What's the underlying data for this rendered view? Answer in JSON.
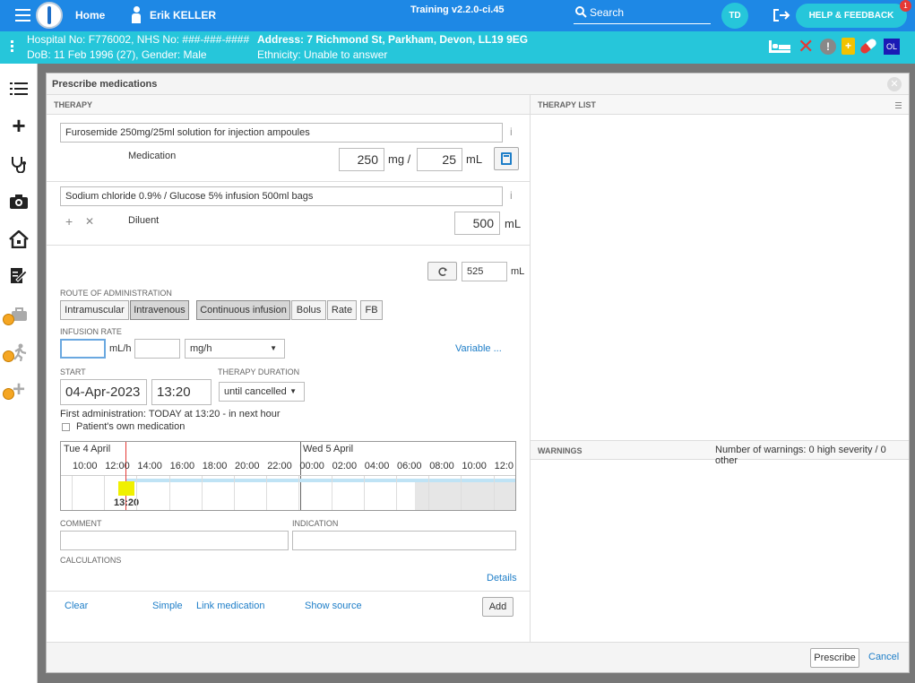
{
  "topbar": {
    "home": "Home",
    "user": "Erik KELLER",
    "version": "Training v2.2.0-ci.45",
    "search": "Search",
    "initials": "TD",
    "help": "HELP & FEEDBACK",
    "notif": "1"
  },
  "patient": {
    "line1": "Hospital No: F776002, NHS No: ###-###-####",
    "addr": "Address: 7 Richmond St, Parkham, Devon, LL19 9EG",
    "line2": "DoB: 11 Feb 1996 (27), Gender: Male",
    "eth": "Ethnicity: Unable to answer",
    "ol": "OL"
  },
  "dialog": {
    "title": "Prescribe medications",
    "therapy_hdr": "THERAPY",
    "therapylist_hdr": "THERAPY LIST",
    "warnings_hdr": "WARNINGS",
    "warnings_count": "Number of warnings: 0 high severity / 0 other"
  },
  "med": {
    "name": "Furosemide 250mg/25ml solution for injection ampoules",
    "label": "Medication",
    "dose": "250",
    "dose_unit": "mg /",
    "vol": "25",
    "vol_unit": "mL"
  },
  "diluent": {
    "name": "Sodium chloride 0.9% / Glucose 5% infusion 500ml bags",
    "label": "Diluent",
    "vol": "500",
    "unit": "mL"
  },
  "total": {
    "value": "525",
    "unit": "mL"
  },
  "route": {
    "label": "ROUTE OF ADMINISTRATION",
    "im": "Intramuscular",
    "iv": "Intravenous",
    "cont": "Continuous infusion",
    "bolus": "Bolus",
    "rate": "Rate",
    "fb": "FB"
  },
  "rate": {
    "label": "INFUSION RATE",
    "unit1": "mL/h",
    "unit2": "mg/h",
    "variable": "Variable ..."
  },
  "start": {
    "label": "START",
    "date": "04-Apr-2023",
    "time": "13:20",
    "duration_label": "THERAPY DURATION",
    "duration": "until cancelled",
    "first": "First administration: TODAY at 13:20 - in next hour",
    "own": "Patient's own medication"
  },
  "timeline": {
    "day1": "Tue 4 April",
    "day2": "Wed 5 April",
    "ticks": [
      "10:00",
      "12:00",
      "14:00",
      "16:00",
      "18:00",
      "20:00",
      "22:00",
      "00:00",
      "02:00",
      "04:00",
      "06:00",
      "08:00",
      "10:00",
      "12:0"
    ],
    "marker": "13:20"
  },
  "comment": {
    "label": "COMMENT",
    "indication": "INDICATION",
    "calc": "CALCULATIONS",
    "details": "Details"
  },
  "footer": {
    "clear": "Clear",
    "simple": "Simple",
    "link": "Link medication",
    "source": "Show source",
    "add": "Add",
    "prescribe": "Prescribe",
    "cancel": "Cancel"
  }
}
